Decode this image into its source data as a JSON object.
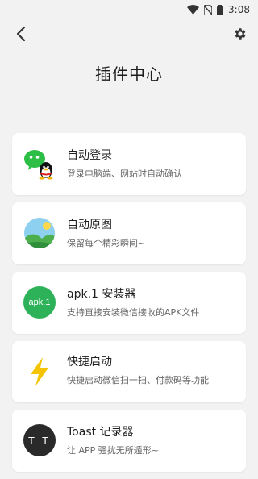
{
  "status_bar": {
    "time": "3:08"
  },
  "page": {
    "title": "插件中心"
  },
  "plugins": [
    {
      "title": "自动登录",
      "desc": "登录电脑端、网站时自动确认",
      "icon": "wechat-qq-icon"
    },
    {
      "title": "自动原图",
      "desc": "保留每个精彩瞬间~",
      "icon": "landscape-photo-icon"
    },
    {
      "title": "apk.1 安装器",
      "desc": "支持直接安装微信接收的APK文件",
      "icon": "apk-installer-icon",
      "icon_text": "apk.1"
    },
    {
      "title": "快捷启动",
      "desc": "快捷启动微信扫一扫、付款码等功能",
      "icon": "lightning-icon"
    },
    {
      "title": "Toast 记录器",
      "desc": "让 APP 骚扰无所遁形~",
      "icon": "toast-recorder-icon",
      "icon_text": "T T"
    }
  ],
  "colors": {
    "background": "#f2f2f2",
    "card": "#ffffff",
    "apk_green": "#2db25a",
    "bolt_yellow": "#f5c400"
  }
}
